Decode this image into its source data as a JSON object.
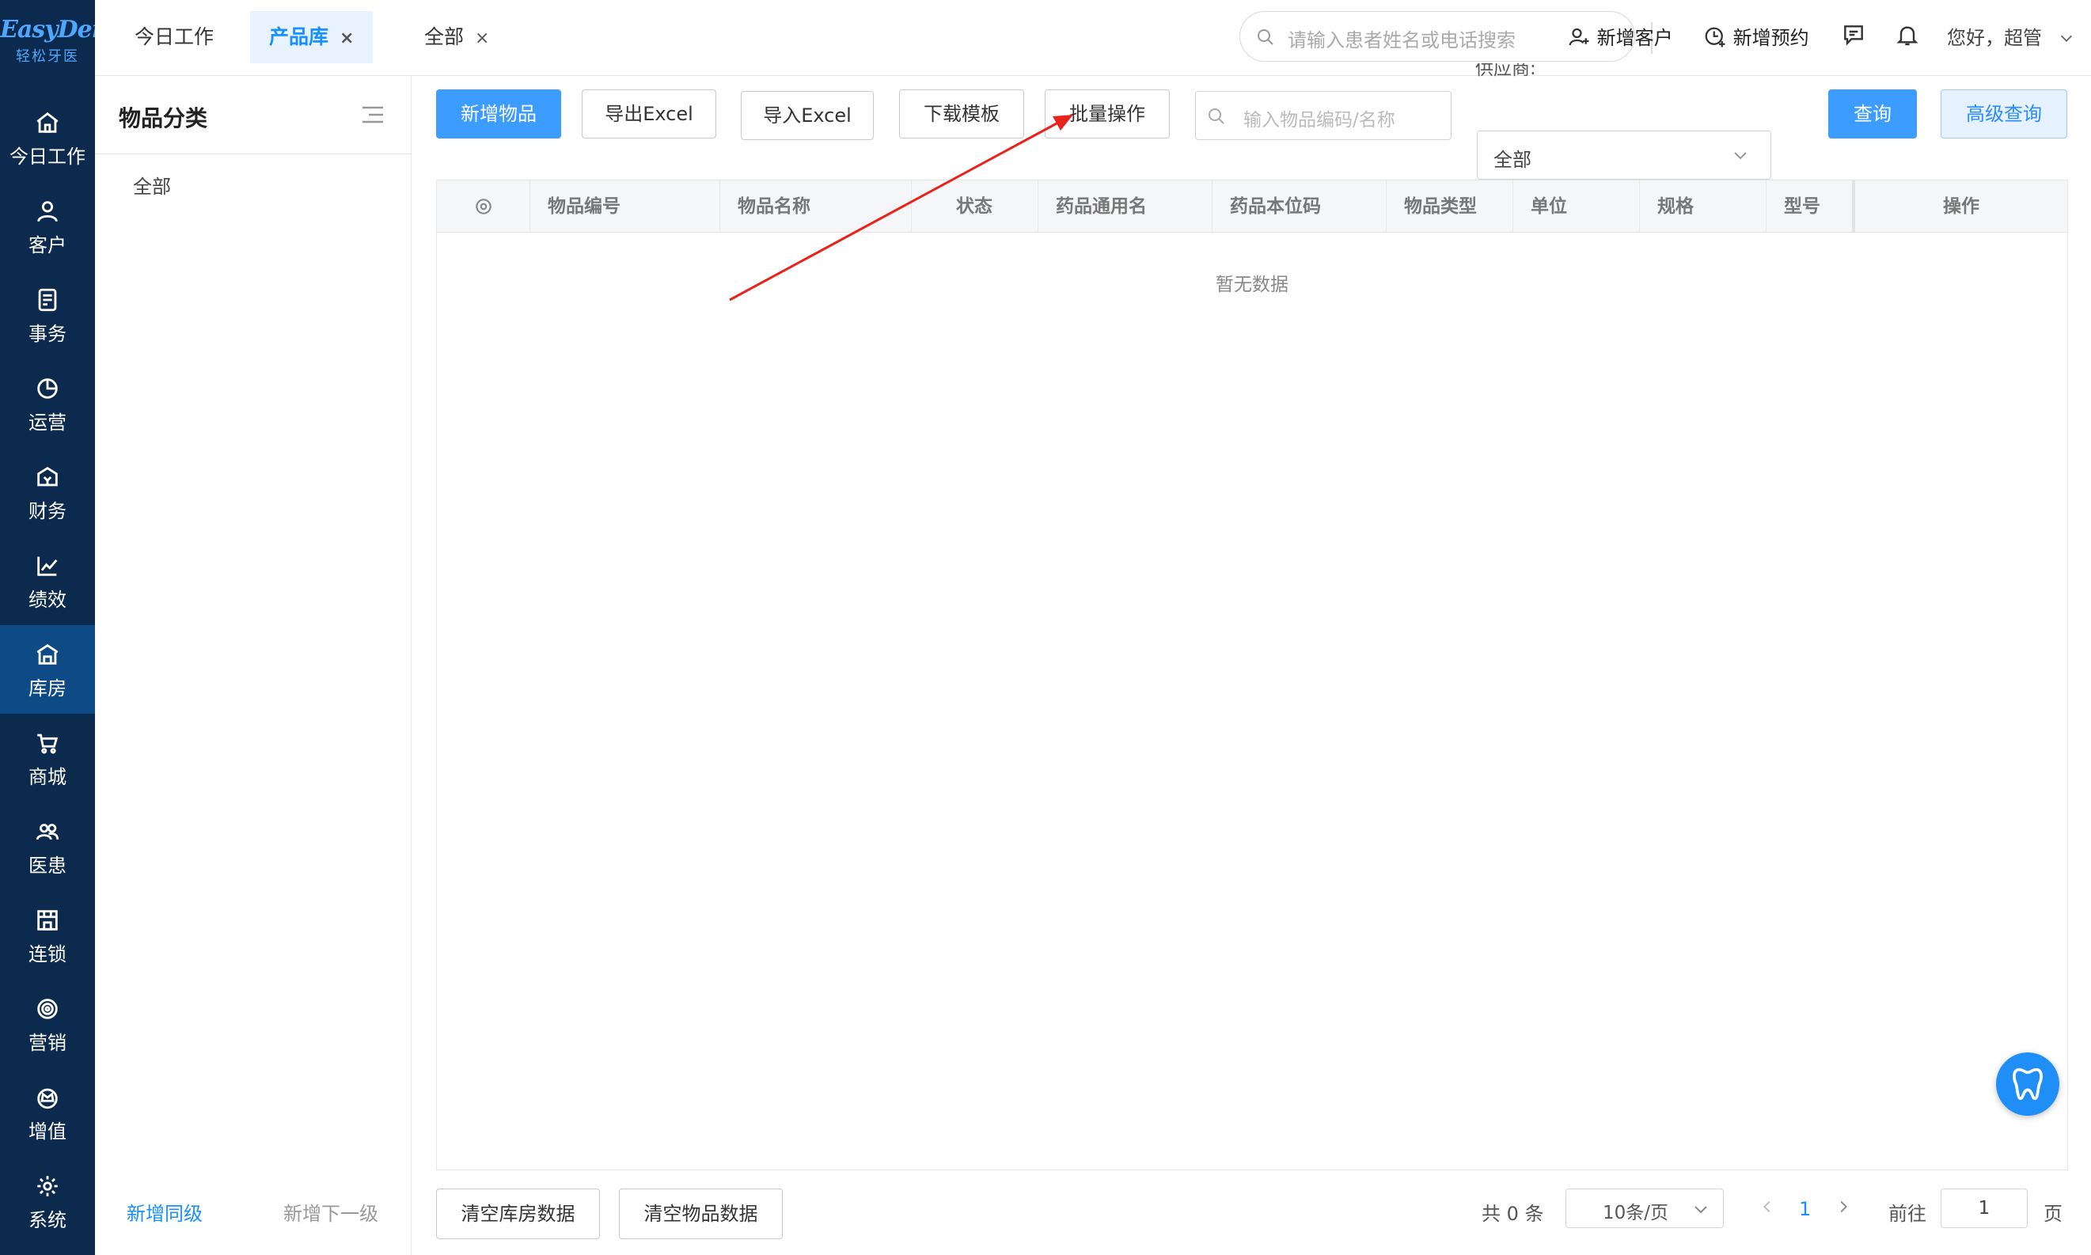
{
  "app": {
    "logo_text": "EasyDent",
    "logo_sub": "轻松牙医"
  },
  "rail": {
    "items": [
      {
        "label": "今日工作",
        "icon": "home-icon"
      },
      {
        "label": "客户",
        "icon": "user-icon"
      },
      {
        "label": "事务",
        "icon": "document-icon"
      },
      {
        "label": "运营",
        "icon": "pie-chart-icon"
      },
      {
        "label": "财务",
        "icon": "wallet-icon"
      },
      {
        "label": "绩效",
        "icon": "line-chart-icon"
      },
      {
        "label": "库房",
        "icon": "warehouse-icon"
      },
      {
        "label": "商城",
        "icon": "cart-icon"
      },
      {
        "label": "医患",
        "icon": "users-icon"
      },
      {
        "label": "连锁",
        "icon": "store-icon"
      },
      {
        "label": "营销",
        "icon": "target-icon"
      },
      {
        "label": "增值",
        "icon": "crown-icon"
      },
      {
        "label": "系统",
        "icon": "gear-icon"
      }
    ],
    "active": "库房"
  },
  "tabs": [
    {
      "label": "今日工作",
      "closable": false
    },
    {
      "label": "产品库",
      "closable": true,
      "active": true
    },
    {
      "label": "全部",
      "closable": true
    }
  ],
  "header": {
    "search_placeholder": "请输入患者姓名或电话搜索",
    "new_customer": "新增客户",
    "new_appointment": "新增预约",
    "greeting": "您好，超管"
  },
  "category": {
    "title": "物品分类",
    "items": [
      "全部"
    ],
    "add_sibling": "新增同级",
    "add_child": "新增下一级"
  },
  "toolbar": {
    "add_item": "新增物品",
    "export_excel": "导出Excel",
    "import_excel": "导入Excel",
    "download_template": "下载模板",
    "batch_ops": "批量操作",
    "item_search_placeholder": "输入物品编码/名称",
    "supplier_label": "供应商:",
    "supplier_value": "全部",
    "query": "查询",
    "advanced_query": "高级查询"
  },
  "table": {
    "columns": [
      "物品编号",
      "物品名称",
      "状态",
      "药品通用名",
      "药品本位码",
      "物品类型",
      "单位",
      "规格",
      "型号",
      "操作"
    ],
    "empty_text": "暂无数据"
  },
  "footer": {
    "clear_warehouse": "清空库房数据",
    "clear_items": "清空物品数据",
    "total": "共 0 条",
    "page_size": "10条/页",
    "current_page": "1",
    "goto_label": "前往",
    "goto_value": "1",
    "page_suffix": "页"
  },
  "colors": {
    "rail_bg": "#0c2a4d",
    "rail_active": "#0e4a86",
    "primary": "#3d9cff",
    "annotation_arrow": "#e8231c"
  }
}
